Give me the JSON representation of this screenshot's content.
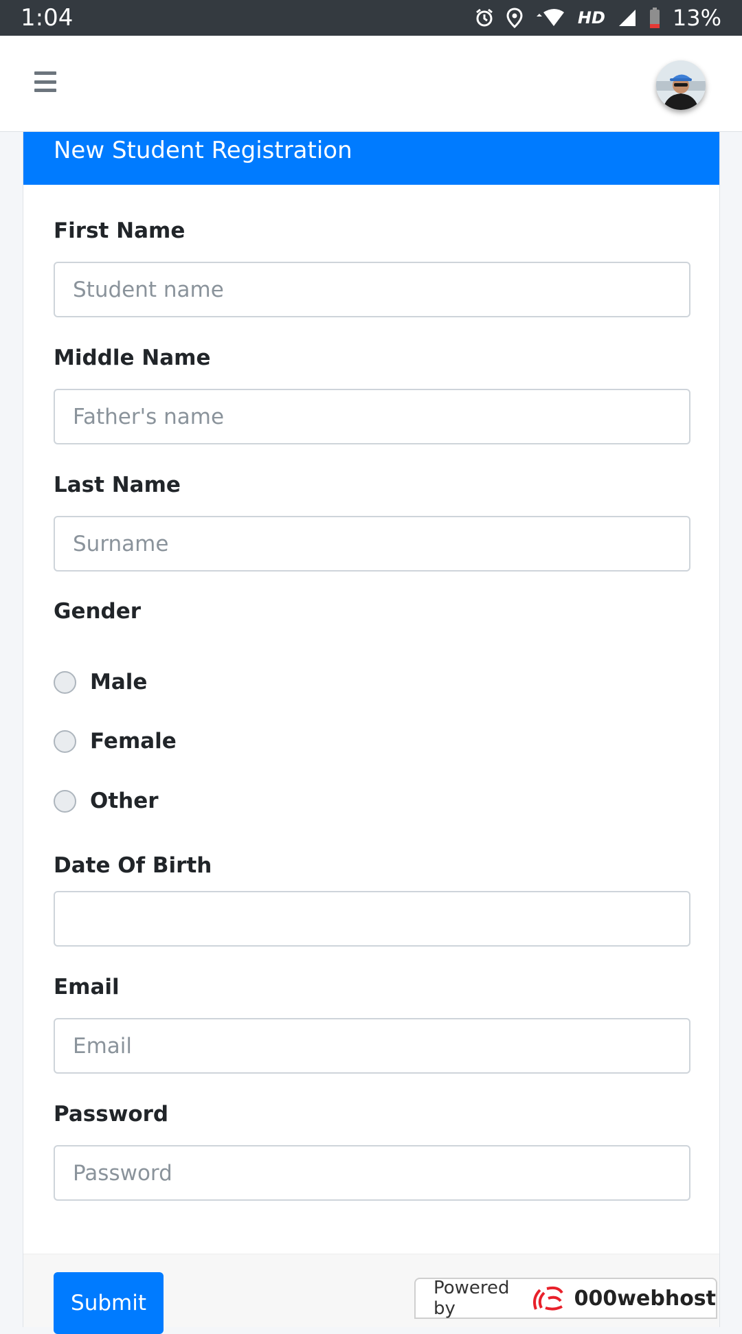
{
  "status_bar": {
    "time": "1:04",
    "network_label": "HD",
    "battery_percent": "13%"
  },
  "header": {
    "menu_icon": "hamburger-icon",
    "avatar_icon": "user-avatar"
  },
  "card": {
    "title": "New Student Registration",
    "accent_color": "#007bff"
  },
  "form": {
    "first_name": {
      "label": "First Name",
      "placeholder": "Student name"
    },
    "middle_name": {
      "label": "Middle Name",
      "placeholder": "Father's name"
    },
    "last_name": {
      "label": "Last Name",
      "placeholder": "Surname"
    },
    "gender": {
      "label": "Gender",
      "options": [
        "Male",
        "Female",
        "Other"
      ]
    },
    "dob": {
      "label": "Date Of Birth",
      "placeholder": ""
    },
    "email": {
      "label": "Email",
      "placeholder": "Email"
    },
    "password": {
      "label": "Password",
      "placeholder": "Password"
    },
    "submit_label": "Submit"
  },
  "footer_badge": {
    "powered_by": "Powered by",
    "brand": "000webhost"
  }
}
